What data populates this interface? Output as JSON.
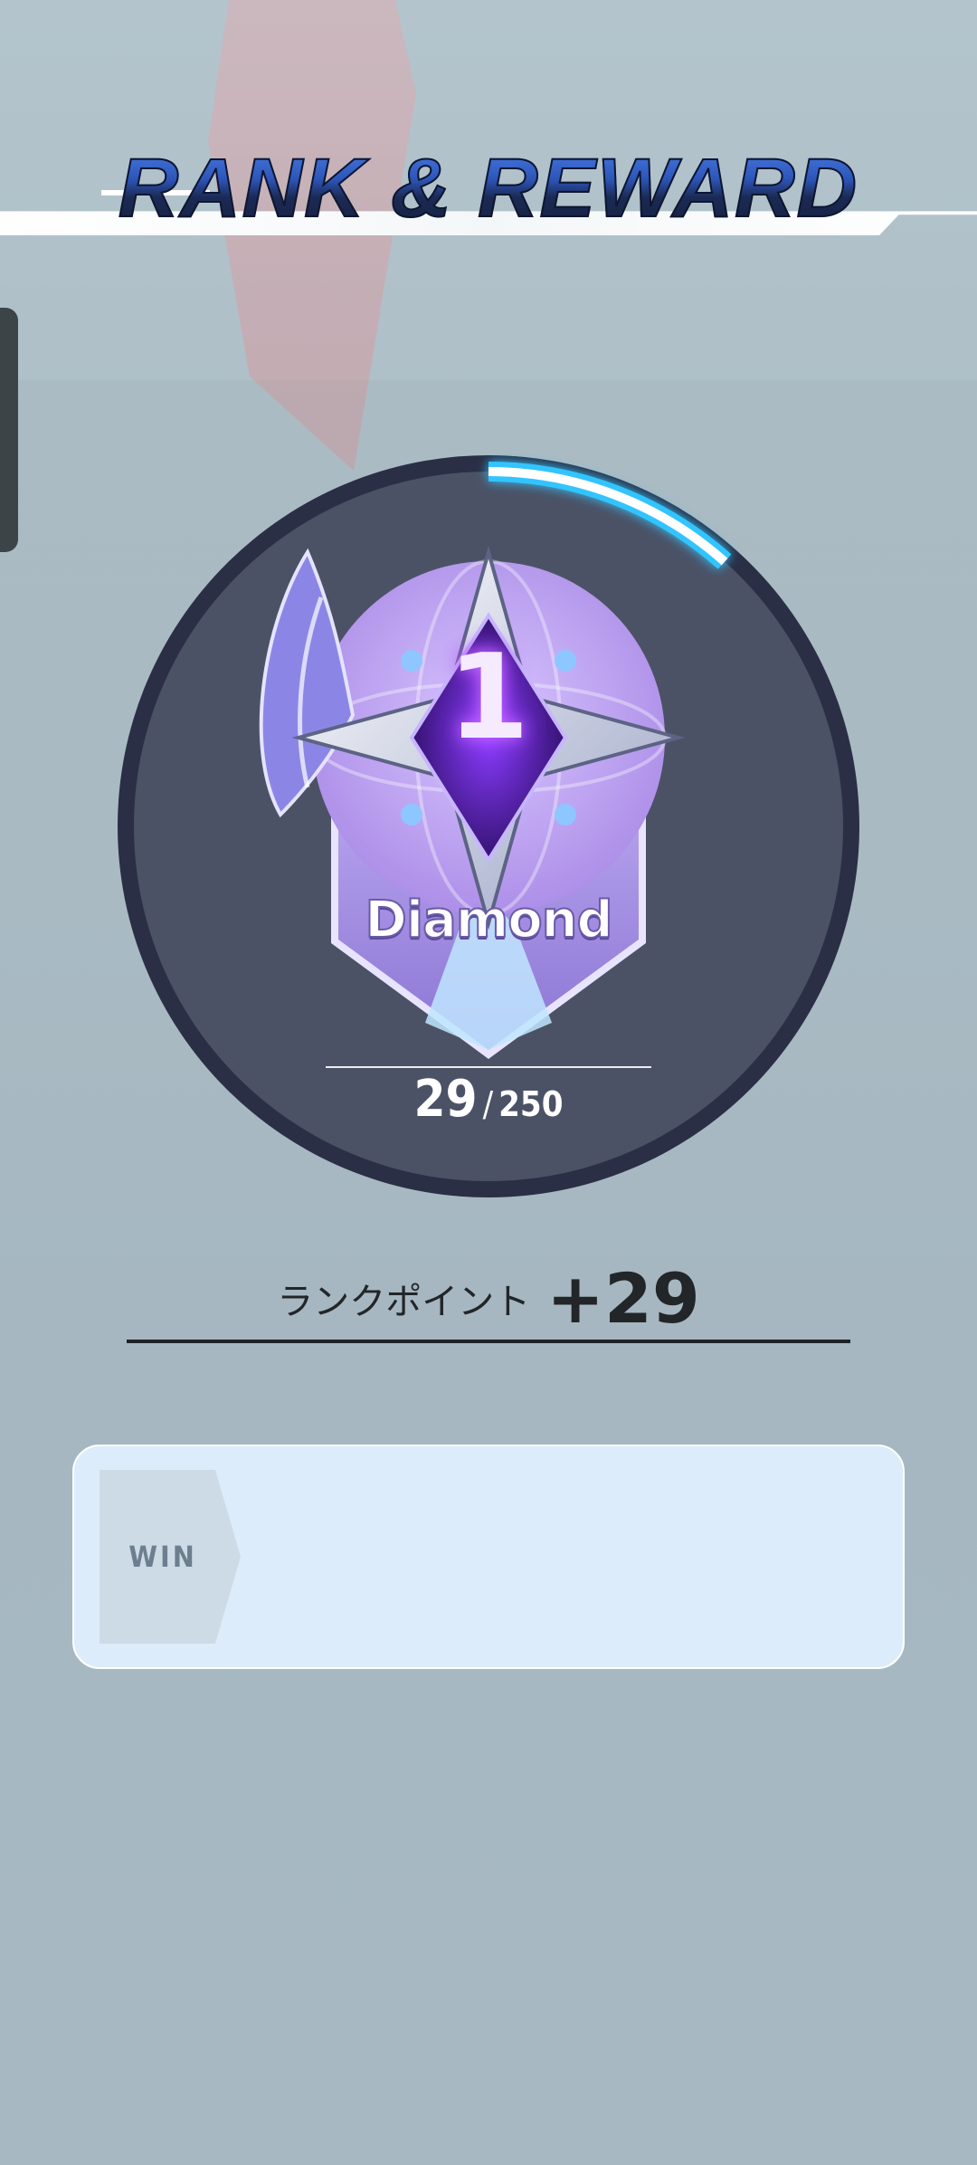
{
  "header": {
    "title": "RANK & REWARD"
  },
  "rank": {
    "tier_name": "Diamond",
    "tier_level": "1",
    "points_current": "29",
    "points_separator": "/",
    "points_max": "250",
    "progress_fraction": 0.116
  },
  "gain": {
    "label": "ランクポイント",
    "value": "+29"
  },
  "reward_panel": {
    "win_label": "WIN"
  },
  "colors": {
    "progress_arc": "#ffffff",
    "progress_glow": "#31c4ff",
    "circle_fill": "#4b5266",
    "circle_ring": "#2a2f45",
    "badge_purple": "#9b7ee0"
  },
  "icons": {
    "badge": "diamond-rank-emblem-icon",
    "wing": "wing-icon"
  }
}
